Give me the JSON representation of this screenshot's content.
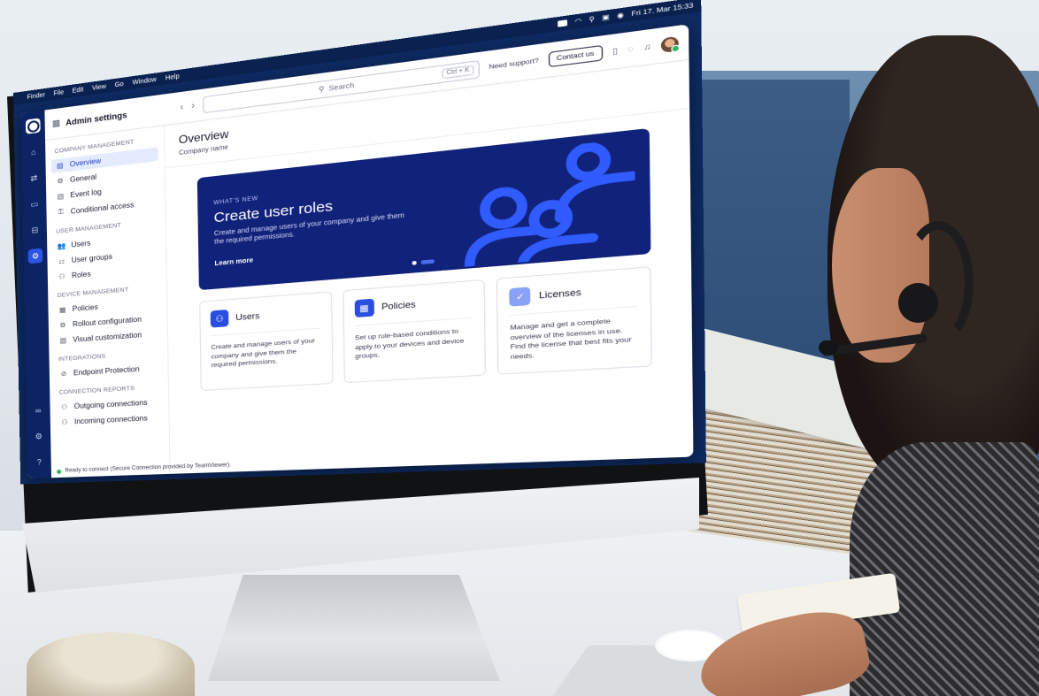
{
  "menubar": {
    "apple": "",
    "items": [
      "Finder",
      "File",
      "Edit",
      "View",
      "Go",
      "Window",
      "Help"
    ],
    "clock": "Fri 17. Mar 15:33"
  },
  "app": {
    "title": "Admin settings",
    "search": {
      "placeholder": "Search",
      "shortcut": "Ctrl + K"
    },
    "support_text": "Need support?",
    "contact_button": "Contact us"
  },
  "rail": {
    "icons": [
      "home-icon",
      "transfer-icon",
      "remote-screen-icon",
      "devices-icon",
      "admin-icon",
      "share-icon",
      "settings-icon",
      "help-icon"
    ]
  },
  "sidebar": {
    "sections": [
      {
        "label": "COMPANY MANAGEMENT",
        "items": [
          {
            "label": "Overview",
            "icon": "▤",
            "active": true
          },
          {
            "label": "General",
            "icon": "⚙"
          },
          {
            "label": "Event log",
            "icon": "▤"
          },
          {
            "label": "Conditional access",
            "icon": "⚿"
          }
        ]
      },
      {
        "label": "USER MANAGEMENT",
        "items": [
          {
            "label": "Users",
            "icon": "👥"
          },
          {
            "label": "User groups",
            "icon": "⚏"
          },
          {
            "label": "Roles",
            "icon": "⚇"
          }
        ]
      },
      {
        "label": "DEVICE MANAGEMENT",
        "items": [
          {
            "label": "Policies",
            "icon": "▦"
          },
          {
            "label": "Rollout configuration",
            "icon": "⚙"
          },
          {
            "label": "Visual customization",
            "icon": "▧"
          }
        ]
      },
      {
        "label": "INTEGRATIONS",
        "items": [
          {
            "label": "Endpoint Protection",
            "icon": "⊘"
          }
        ]
      },
      {
        "label": "CONNECTION REPORTS",
        "items": [
          {
            "label": "Outgoing connections",
            "icon": "⚇"
          },
          {
            "label": "Incoming connections",
            "icon": "⚇"
          }
        ]
      }
    ],
    "status": "Ready to connect (Secure Connection provided by TeamViewer)."
  },
  "main": {
    "title": "Overview",
    "subtitle": "Company name",
    "banner": {
      "eyebrow": "WHAT'S NEW",
      "title": "Create user roles",
      "description": "Create and manage users of your company and give them the required permissions.",
      "link": "Learn more"
    },
    "cards": [
      {
        "title": "Users",
        "description": "Create and manage users of your company and give them the required permissions."
      },
      {
        "title": "Policies",
        "description": "Set up rule-based conditions to apply to your devices and device groups."
      },
      {
        "title": "Licenses",
        "description": "Manage and get a complete overview of the licenses in use. Find the license that best fits your needs."
      }
    ]
  },
  "colors": {
    "brand": "#0d2464",
    "accent": "#2a4ee0",
    "banner": "#11227a",
    "status_ok": "#2eb85c"
  }
}
